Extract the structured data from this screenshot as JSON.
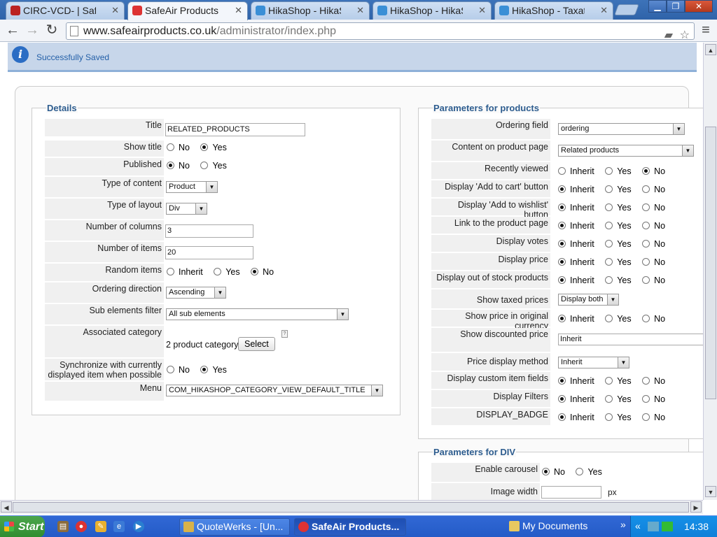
{
  "browser": {
    "tabs": [
      {
        "label": "CIRC-VCD- | SafeAi",
        "icon": "joomla-icon",
        "color": "#b22"
      },
      {
        "label": "SafeAir Products Ltd",
        "icon": "joomla-icon",
        "color": "#d33",
        "active": true
      },
      {
        "label": "HikaShop - HikaSho",
        "icon": "hikashop-icon",
        "color": "#3a8fd6"
      },
      {
        "label": "HikaShop - HikaSho",
        "icon": "hikashop-icon",
        "color": "#3a8fd6"
      },
      {
        "label": "HikaShop - Taxatio",
        "icon": "hikashop-icon",
        "color": "#3a8fd6"
      }
    ],
    "url_host": "www.safeairproducts.co.uk",
    "url_path": "/administrator/index.php"
  },
  "message": {
    "text": "Successfully Saved"
  },
  "details": {
    "legend": "Details",
    "title_label": "Title",
    "title_value": "RELATED_PRODUCTS",
    "show_title_label": "Show title",
    "published_label": "Published",
    "type_content_label": "Type of content",
    "type_content_value": "Product",
    "type_layout_label": "Type of layout",
    "type_layout_value": "Div",
    "columns_label": "Number of columns",
    "columns_value": "3",
    "items_label": "Number of items",
    "items_value": "20",
    "random_label": "Random items",
    "ordering_dir_label": "Ordering direction",
    "ordering_dir_value": "Ascending",
    "sub_filter_label": "Sub elements filter",
    "sub_filter_value": "All sub elements",
    "assoc_cat_label": "Associated category",
    "assoc_cat_value": "2 product category",
    "select_label": "Select",
    "sync_label_1": "Synchronize with currently",
    "sync_label_2": "displayed item when possible",
    "menu_label": "Menu",
    "menu_value": "COM_HIKASHOP_CATEGORY_VIEW_DEFAULT_TITLE"
  },
  "options": {
    "no": "No",
    "yes": "Yes",
    "inherit": "Inherit"
  },
  "params": {
    "legend": "Parameters for products",
    "ordering_field_label": "Ordering field",
    "ordering_field_value": "ordering",
    "content_label": "Content on product page",
    "content_value": "Related products",
    "recently_viewed_label": "Recently viewed",
    "add_cart_label": "Display 'Add to cart' button",
    "add_wishlist_label": "Display 'Add to wishlist' button",
    "link_product_label": "Link to the product page",
    "votes_label": "Display votes",
    "price_label": "Display price",
    "out_stock_label": "Display out of stock products",
    "taxed_label": "Show taxed prices",
    "taxed_value": "Display both",
    "orig_currency_label": "Show price in original currency",
    "discounted_label": "Show discounted price",
    "discounted_value": "Inherit",
    "price_method_label": "Price display method",
    "price_method_value": "Inherit",
    "custom_fields_label": "Display custom item fields",
    "filters_label": "Display Filters",
    "badge_label": "DISPLAY_BADGE"
  },
  "div_params": {
    "legend": "Parameters for DIV",
    "carousel_label": "Enable carousel",
    "image_width_label": "Image width",
    "px_unit": "px"
  },
  "taskbar": {
    "start": "Start",
    "tasks": [
      "QuoteWerks - [Un...",
      "SafeAir Products..."
    ],
    "my_documents": "My Documents",
    "clock": "14:38"
  }
}
